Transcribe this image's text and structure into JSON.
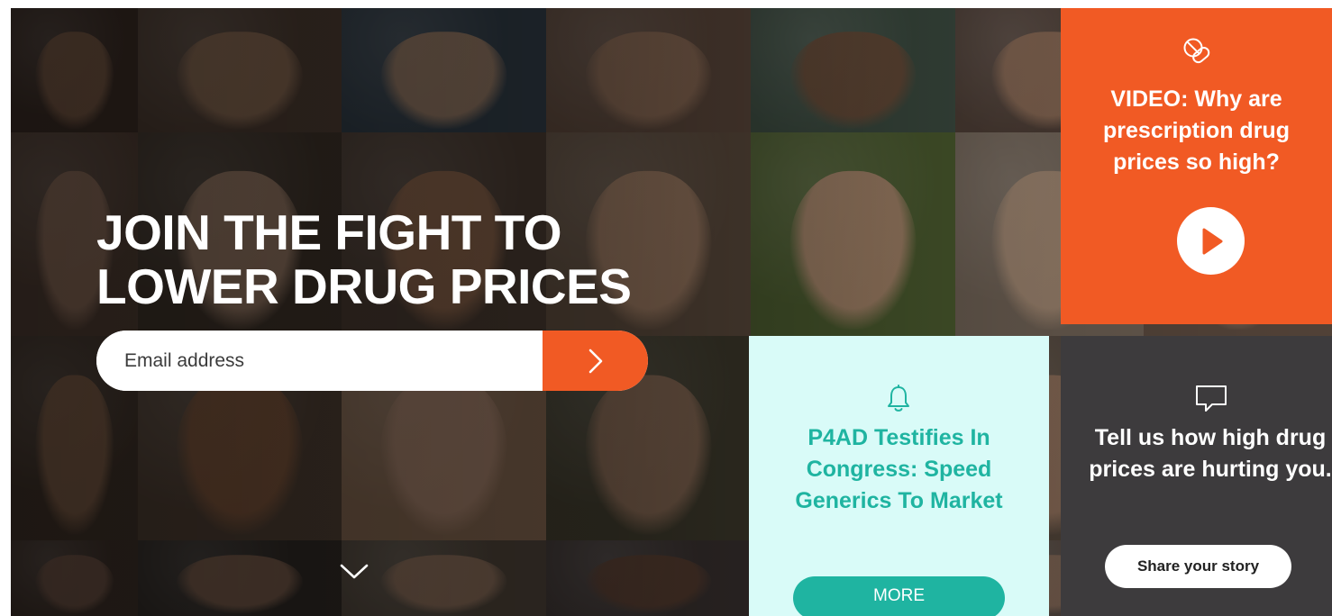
{
  "hero": {
    "headline_line1": "JOIN THE FIGHT TO",
    "headline_line2": "LOWER DRUG PRICES",
    "email_placeholder": "Email address",
    "submit_icon": "chevron-right-icon",
    "scroll_icon": "chevron-down-icon"
  },
  "video_card": {
    "icon": "pill-icon",
    "title": "VIDEO: Why are prescription drug prices so high?",
    "play_icon": "play-icon",
    "background": "#f15a24"
  },
  "news_card": {
    "icon": "bell-icon",
    "title": "P4AD Testifies In Congress: Speed Generics To Market",
    "button_label": "MORE",
    "background": "#d9fbf8",
    "accent": "#1fb4a1"
  },
  "story_card": {
    "icon": "chat-bubble-icon",
    "title": "Tell us how high drug prices are hurting you.",
    "button_label": "Share your story",
    "background": "#3d3b3d"
  },
  "colors": {
    "brand_orange": "#f15a24",
    "teal": "#1fb4a1",
    "dark_gray": "#3d3b3d"
  }
}
